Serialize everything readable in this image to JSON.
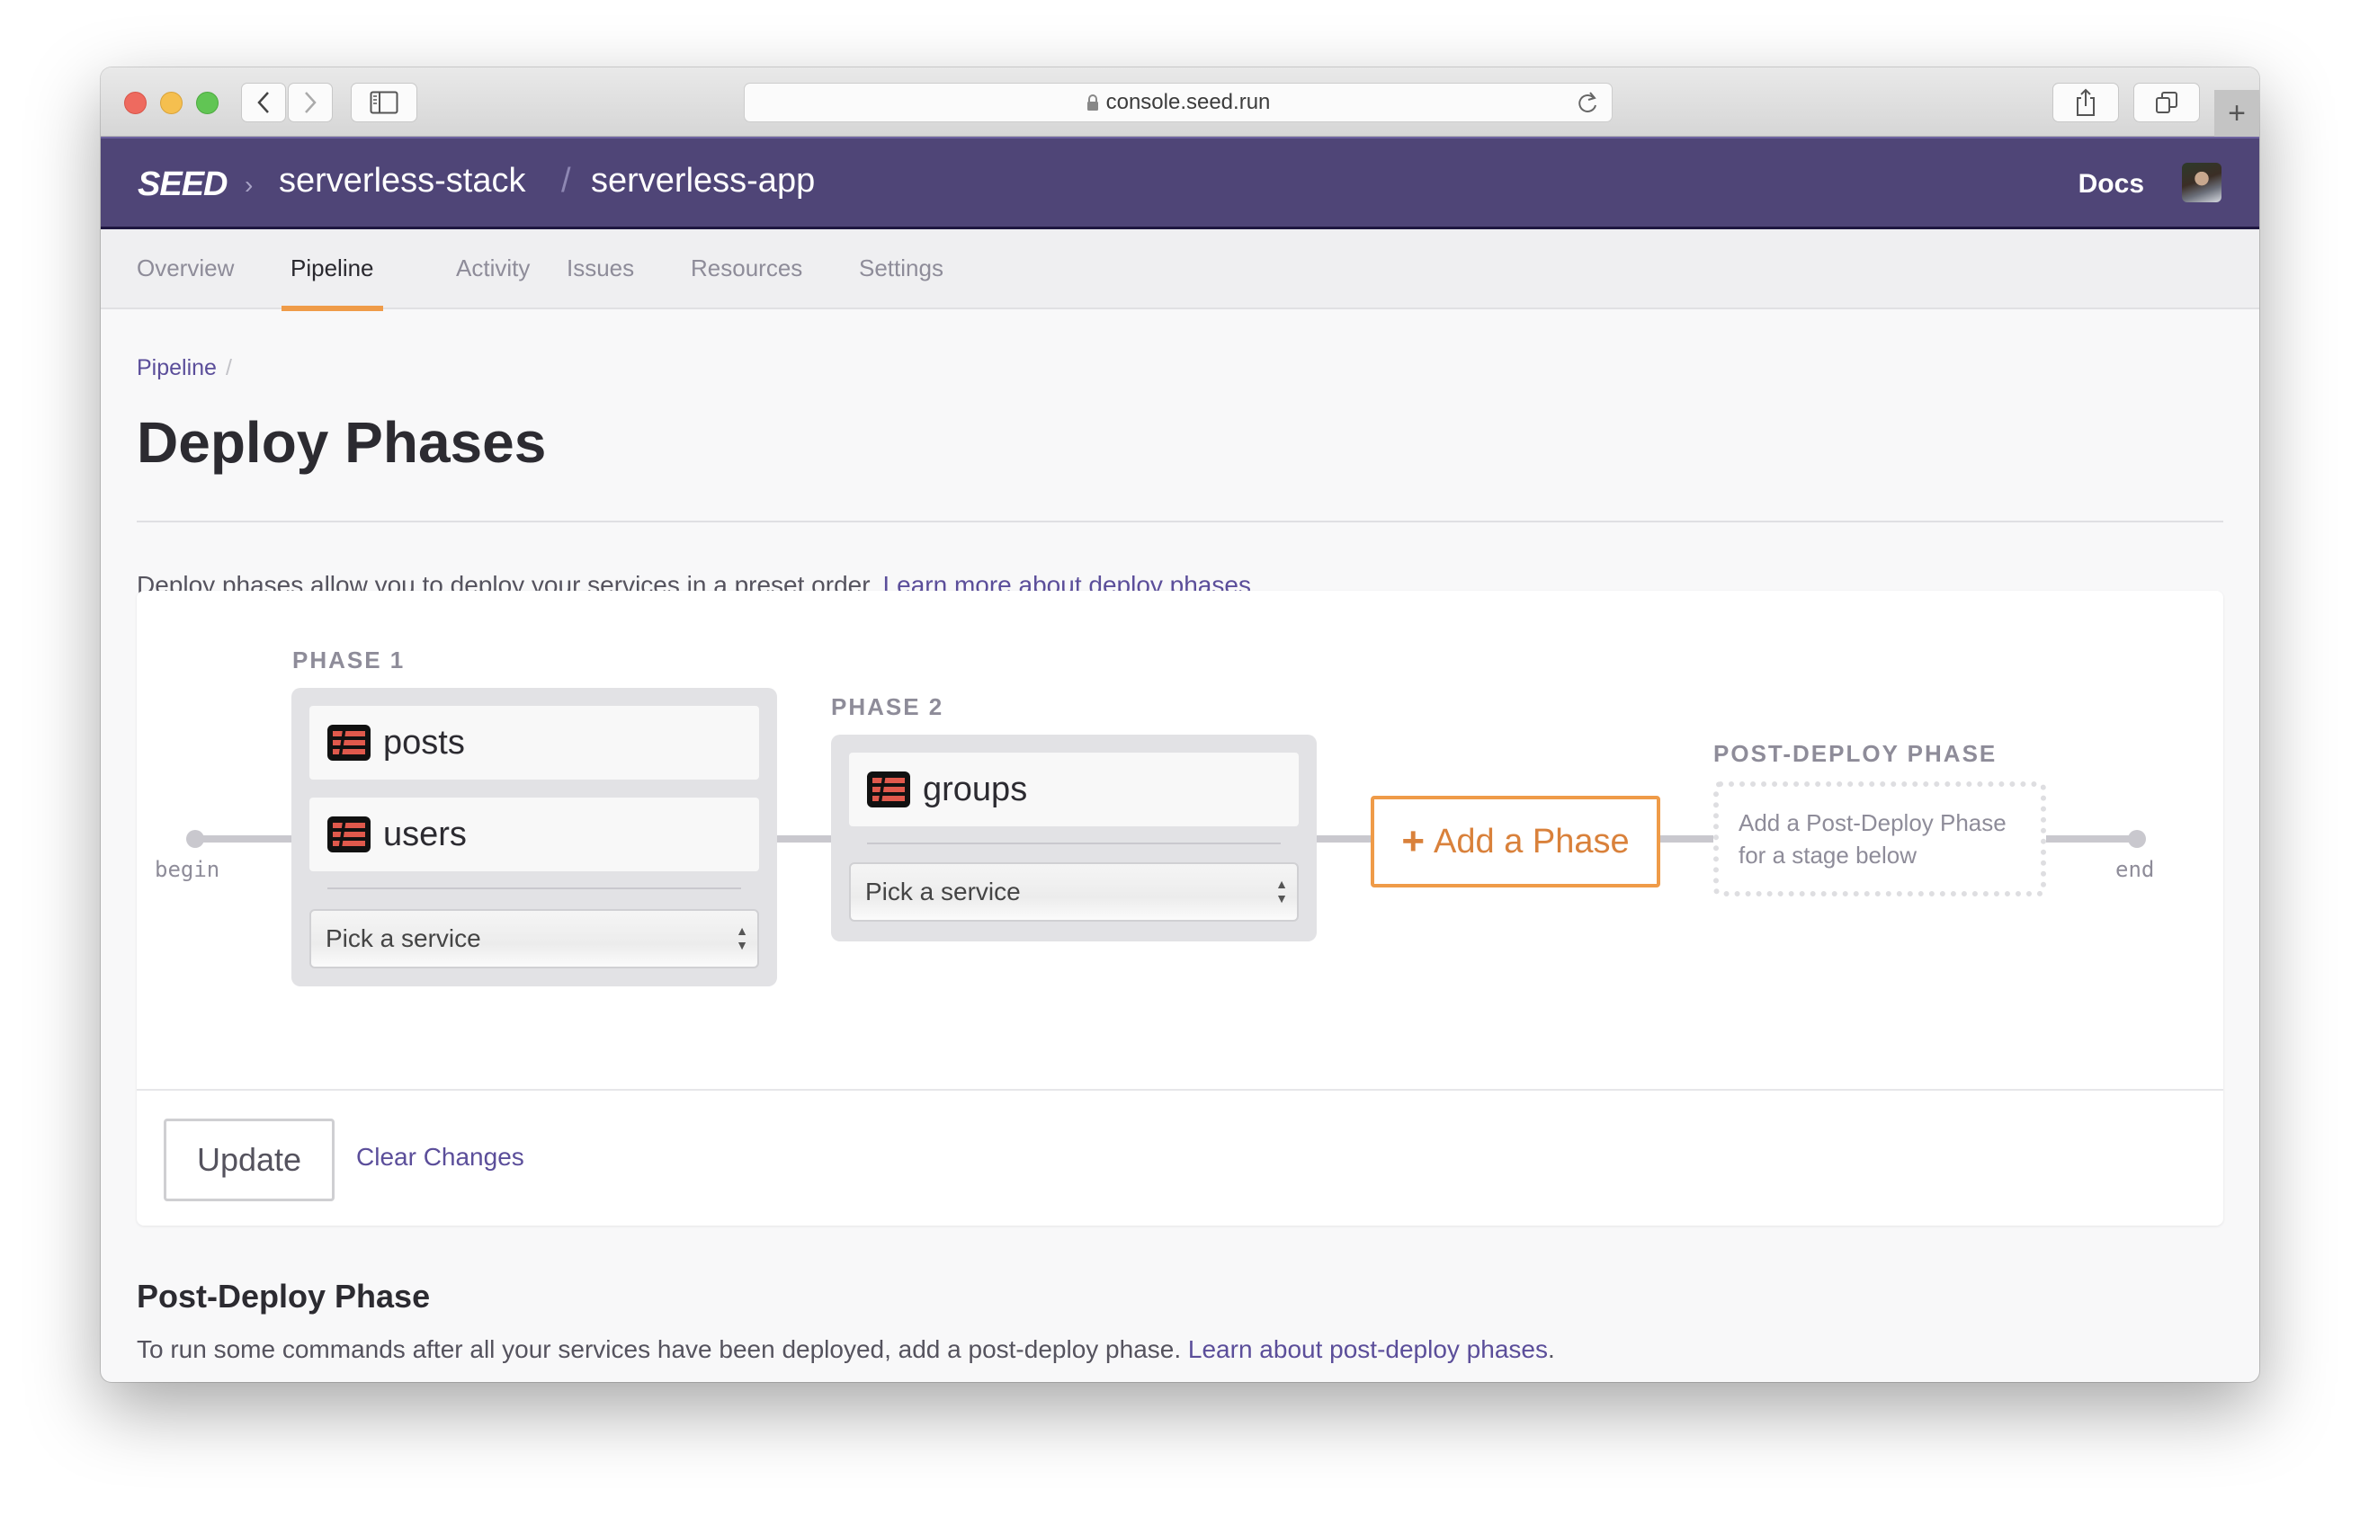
{
  "browser": {
    "url": "console.seed.run",
    "icons": {
      "close": "close-light",
      "minimize": "minimize-light",
      "zoom": "zoom-light",
      "back": "chevron-left-icon",
      "forward": "chevron-right-icon",
      "sidebar": "sidebar-icon",
      "lock": "lock-icon",
      "reload": "reload-icon",
      "share": "share-icon",
      "tabs": "tabs-icon",
      "new_tab": "plus-icon"
    },
    "new_tab_label": "+"
  },
  "header": {
    "logo": "SEED",
    "chevron": "›",
    "org": "serverless-stack",
    "separator": "/",
    "app": "serverless-app",
    "docs": "Docs",
    "brand_color": "#4f4577"
  },
  "tabs": [
    {
      "label": "Overview",
      "active": false
    },
    {
      "label": "Pipeline",
      "active": true
    },
    {
      "label": "Activity",
      "active": false
    },
    {
      "label": "Issues",
      "active": false
    },
    {
      "label": "Resources",
      "active": false
    },
    {
      "label": "Settings",
      "active": false
    }
  ],
  "breadcrumb": {
    "items": [
      "Pipeline"
    ],
    "separator": "/"
  },
  "page": {
    "title": "Deploy Phases",
    "intro_text": "Deploy phases allow you to deploy your services in a preset order.",
    "intro_link": "Learn more about deploy phases",
    "intro_end": "."
  },
  "pipeline": {
    "begin_label": "begin",
    "end_label": "end",
    "phases": [
      {
        "label": "PHASE 1",
        "services": [
          "posts",
          "users"
        ],
        "select_placeholder": "Pick a service"
      },
      {
        "label": "PHASE 2",
        "services": [
          "groups"
        ],
        "select_placeholder": "Pick a service"
      }
    ],
    "add_phase": {
      "icon": "+",
      "label": "Add a Phase"
    },
    "post_deploy": {
      "label": "POST-DEPLOY PHASE",
      "line1": "Add a Post-Deploy Phase",
      "line2": "for a stage below"
    },
    "accent_color": "#ef9b48"
  },
  "footer": {
    "update_label": "Update",
    "clear_label": "Clear Changes"
  },
  "post_deploy_section": {
    "title": "Post-Deploy Phase",
    "text": "To run some commands after all your services have been deployed, add a post-deploy phase.",
    "link": "Learn about post-deploy phases",
    "end": "."
  }
}
